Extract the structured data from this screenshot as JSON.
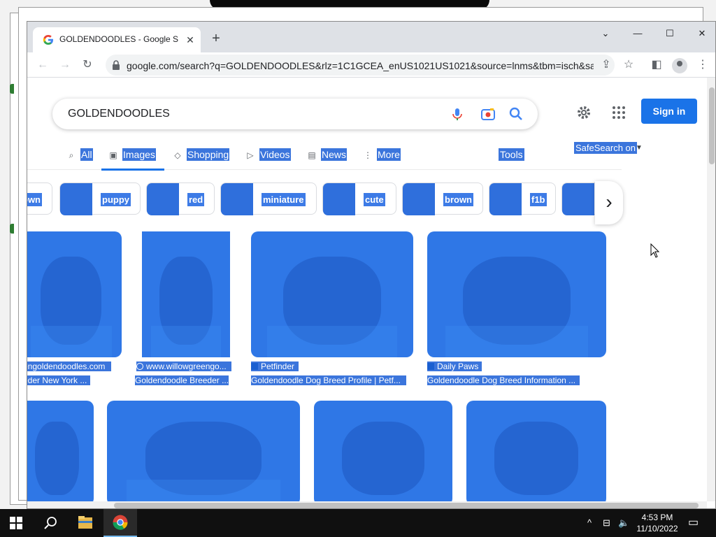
{
  "browser": {
    "tab_title": "GOLDENDOODLES - Google Sea",
    "url": "google.com/search?q=GOLDENDOODLES&rlz=1C1GCEA_enUS1021US1021&source=lnms&tbm=isch&sa..."
  },
  "search": {
    "query": "GOLDENDOODLES",
    "signin_label": "Sign in"
  },
  "filters": {
    "tabs": [
      {
        "label": "All",
        "icon": "search-icon"
      },
      {
        "label": "Images",
        "icon": "image-icon"
      },
      {
        "label": "Shopping",
        "icon": "tag-icon"
      },
      {
        "label": "Videos",
        "icon": "play-icon"
      },
      {
        "label": "News",
        "icon": "news-icon"
      },
      {
        "label": "More",
        "icon": "more-vert-icon"
      }
    ],
    "tools_label": "Tools",
    "safesearch_label": "SafeSearch on"
  },
  "chips": [
    "own",
    "puppy",
    "red",
    "miniature",
    "cute",
    "brown",
    "f1b"
  ],
  "results": [
    {
      "source": "engoldendoodles.com",
      "title": "eder New York ..."
    },
    {
      "source": "www.willowgreengo...",
      "title": "Goldendoodle Breeder ..."
    },
    {
      "source": "Petfinder",
      "title": "Goldendoodle Dog Breed Profile | Petf..."
    },
    {
      "source": "Daily Paws",
      "title": "Goldendoodle Dog Breed Information ..."
    }
  ],
  "taskbar": {
    "time": "4:53 PM",
    "date": "11/10/2022"
  },
  "colors": {
    "selection_overlay": "#3b75dc",
    "google_blue": "#1a73e8"
  }
}
